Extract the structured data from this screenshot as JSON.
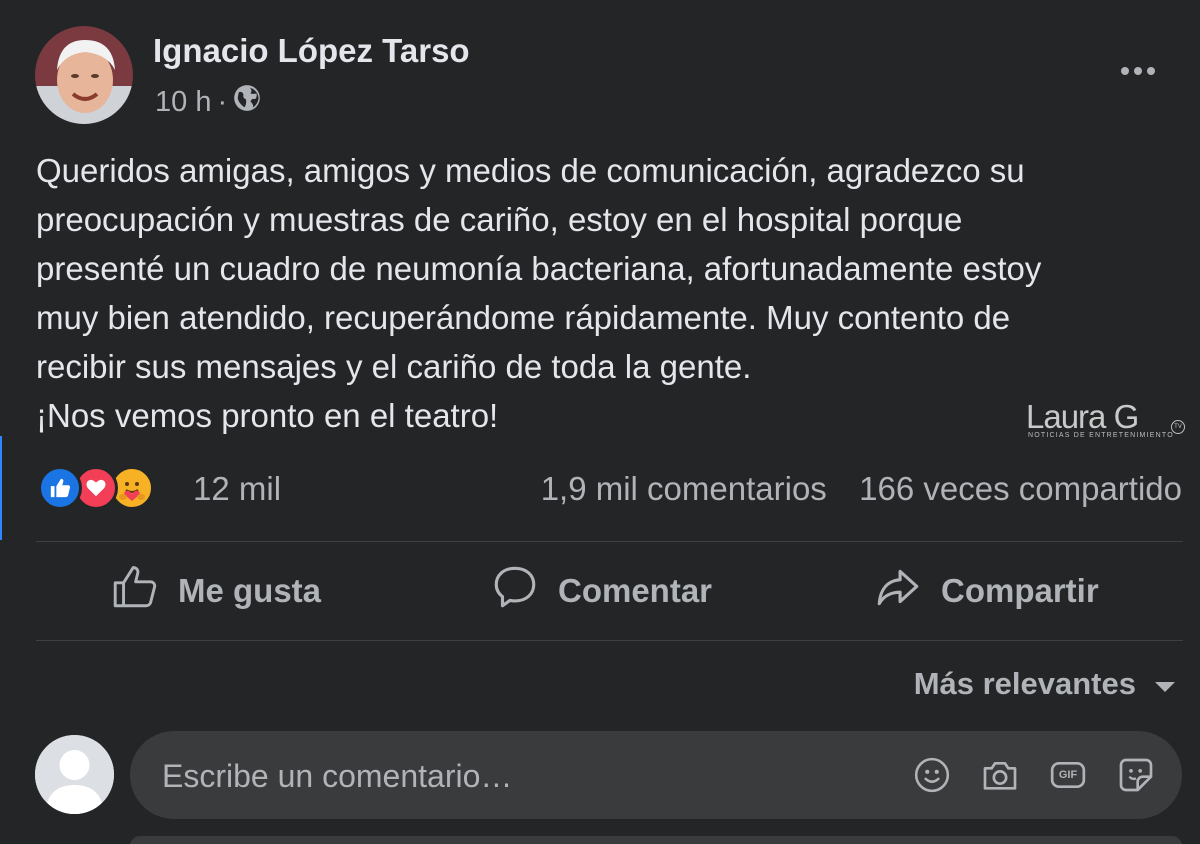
{
  "post": {
    "author": "Ignacio López Tarso",
    "time": "10 h",
    "separator": "·",
    "privacy_icon": "globe-icon",
    "lines": [
      "Queridos amigas, amigos y medios de comunicación, agradezco su",
      "preocupación y muestras de cariño, estoy en el hospital porque",
      "presenté un cuadro de neumonía bacteriana, afortunadamente estoy",
      "muy bien atendido, recuperándome rápidamente. Muy contento de",
      "recibir sus mensajes y el cariño de toda la gente.",
      "¡Nos vemos pronto en el teatro!"
    ]
  },
  "watermark": {
    "logo": "Laura G",
    "tagline": "NOTICIAS DE ENTRETENIMIENTO",
    "badge": "TV"
  },
  "stats": {
    "reactions": [
      "like",
      "love",
      "care"
    ],
    "reaction_count": "12 mil",
    "comments": "1,9 mil comentarios",
    "shares": "166 veces compartido"
  },
  "actions": {
    "like": "Me gusta",
    "comment": "Comentar",
    "share": "Compartir"
  },
  "comments": {
    "sort_label": "Más relevantes",
    "placeholder": "Escribe un comentario…",
    "gif_label": "GIF"
  },
  "colors": {
    "background": "#242526",
    "input_bg": "#3a3b3c",
    "text_primary": "#e4e6eb",
    "text_secondary": "#b0b3b8",
    "like_blue": "#1b74e4",
    "love_red": "#f33e58",
    "care_yellow": "#f7b125"
  }
}
